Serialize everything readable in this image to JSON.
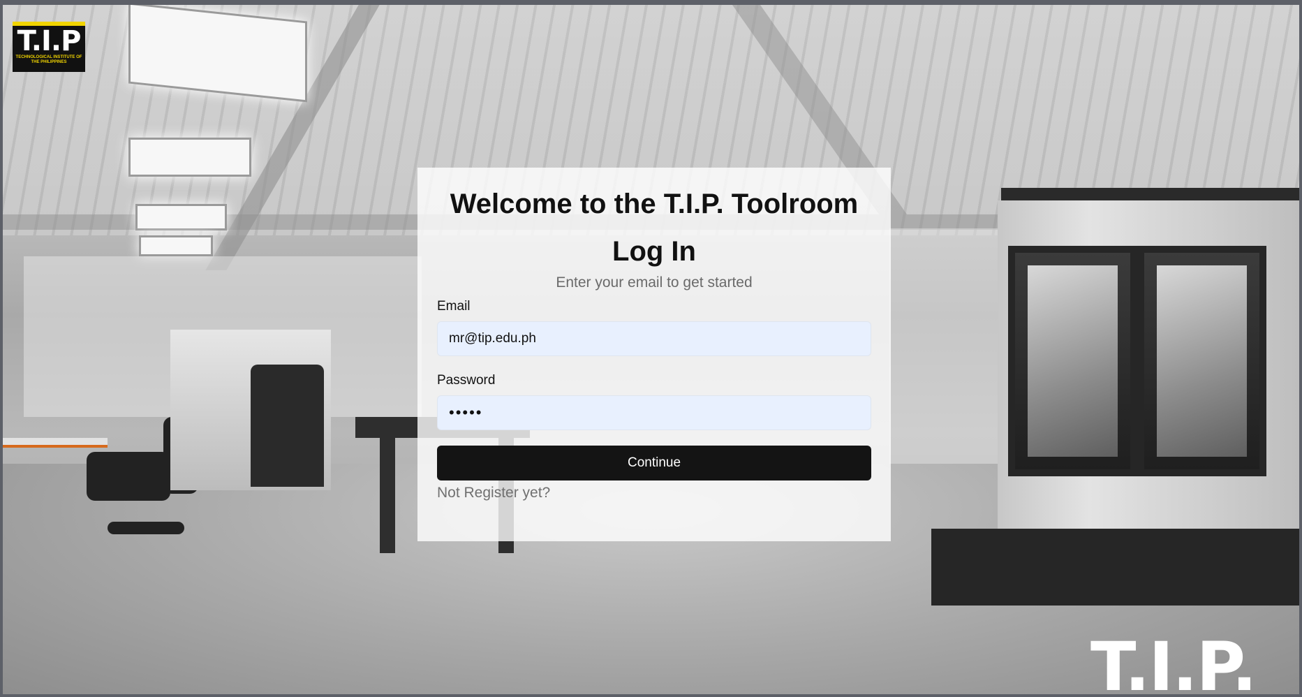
{
  "branding": {
    "logo_mark": "T.I.P",
    "logo_subtext": "TECHNOLOGICAL INSTITUTE OF THE PHILIPPINES",
    "watermark": "T.I.P."
  },
  "login": {
    "title": "Welcome to the T.I.P. Toolroom",
    "heading": "Log In",
    "hint": "Enter your email to get started",
    "email_label": "Email",
    "email_value": "mr@tip.edu.ph",
    "password_label": "Password",
    "password_value": "•••••",
    "continue_label": "Continue",
    "register_link": "Not Register yet?"
  },
  "colors": {
    "brand_yellow": "#f1d400",
    "input_bg": "#e8f0fe",
    "button_bg": "#141414"
  }
}
